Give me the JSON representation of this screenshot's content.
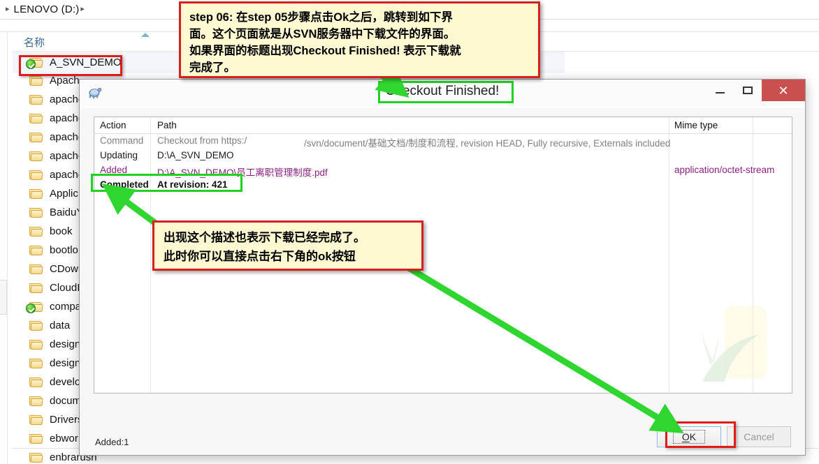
{
  "explorer": {
    "breadcrumb": {
      "leading_icon": "chevron-right-icon",
      "drive_label": "LENOVO (D:)",
      "trailing_icon": "chevron-right-icon"
    },
    "column_header": "名称",
    "status_text": "",
    "files": [
      {
        "name": "A_SVN_DEMO",
        "icon": "folder-icon",
        "overlay": "svn-green-check-badge",
        "selected": true
      },
      {
        "name": "Apach",
        "icon": "folder-icon",
        "overlay": "",
        "selected": false
      },
      {
        "name": "apache",
        "icon": "folder-icon",
        "overlay": "",
        "selected": false
      },
      {
        "name": "apache",
        "icon": "folder-icon",
        "overlay": "",
        "selected": false
      },
      {
        "name": "apache",
        "icon": "folder-icon",
        "overlay": "",
        "selected": false
      },
      {
        "name": "apache",
        "icon": "folder-icon",
        "overlay": "",
        "selected": false
      },
      {
        "name": "apache",
        "icon": "folder-icon",
        "overlay": "",
        "selected": false
      },
      {
        "name": "Applic",
        "icon": "folder-icon",
        "overlay": "",
        "selected": false
      },
      {
        "name": "BaiduY",
        "icon": "folder-icon",
        "overlay": "",
        "selected": false
      },
      {
        "name": "book",
        "icon": "folder-icon",
        "overlay": "",
        "selected": false
      },
      {
        "name": "bootlo",
        "icon": "folder-icon",
        "overlay": "",
        "selected": false
      },
      {
        "name": "CDowr",
        "icon": "folder-icon",
        "overlay": "",
        "selected": false
      },
      {
        "name": "CloudI",
        "icon": "folder-icon",
        "overlay": "",
        "selected": false
      },
      {
        "name": "compa",
        "icon": "folder-icon",
        "overlay": "svn-green-check-badge",
        "selected": false
      },
      {
        "name": "data",
        "icon": "folder-icon",
        "overlay": "",
        "selected": false
      },
      {
        "name": "design",
        "icon": "folder-icon",
        "overlay": "",
        "selected": false
      },
      {
        "name": "design",
        "icon": "folder-icon",
        "overlay": "",
        "selected": false
      },
      {
        "name": "develo",
        "icon": "folder-icon",
        "overlay": "",
        "selected": false
      },
      {
        "name": "docum",
        "icon": "folder-icon",
        "overlay": "",
        "selected": false
      },
      {
        "name": "Drivers",
        "icon": "folder-icon",
        "overlay": "",
        "selected": false
      },
      {
        "name": "ebwor",
        "icon": "folder-icon",
        "overlay": "",
        "selected": false
      },
      {
        "name": "enbrarusn",
        "icon": "folder-icon",
        "overlay": "",
        "selected": false
      }
    ]
  },
  "dialog": {
    "app_icon": "tortoise-svn-turtle-icon",
    "title": "Checkout Finished!",
    "window_buttons": {
      "minimize": "minimize-icon",
      "maximize": "maximize-icon",
      "close": "✕"
    },
    "table": {
      "columns": [
        "Action",
        "Path",
        "Mime type"
      ],
      "rows": [
        {
          "action": "Command",
          "path": "Checkout from https:/",
          "path_cont": "/svn/document/基础文档/制度和流程, revision HEAD, Fully recursive, Externals included",
          "mime": "",
          "style": "gray"
        },
        {
          "action": "Updating",
          "path": "D:\\A_SVN_DEMO",
          "path_cont": "",
          "mime": "",
          "style": "dark"
        },
        {
          "action": "Added",
          "path": "D:\\A_SVN_DEMO\\员工离职管理制度.pdf",
          "path_cont": "",
          "mime": "application/octet-stream",
          "style": "purple"
        },
        {
          "action": "Completed",
          "path": "At revision: 421",
          "path_cont": "",
          "mime": "",
          "style": "bold"
        }
      ]
    },
    "status_summary": "Added:1",
    "buttons": {
      "ok": "OK",
      "ok_mnemonic_prefix": "O",
      "ok_mnemonic_rest": "K",
      "cancel": "Cancel",
      "cancel_enabled": false
    }
  },
  "annotations": {
    "top_note": {
      "lines": [
        "step 06: 在step 05步骤点击Ok之后，跳转到如下界",
        "面。这个页面就是从SVN服务器中下载文件的界面。",
        "如果界面的标题出现Checkout Finished! 表示下载就",
        "完成了。"
      ]
    },
    "middle_note": {
      "lines": [
        "出现这个描述也表示下载已经完成了。",
        "此时你可以直接点击右下角的ok按钮"
      ]
    },
    "highlight_colors": {
      "red_box": "#e01b1b",
      "green_box": "#1fd21f",
      "note_fill": "#fbf8d2",
      "arrow": "#2fd62f"
    }
  }
}
